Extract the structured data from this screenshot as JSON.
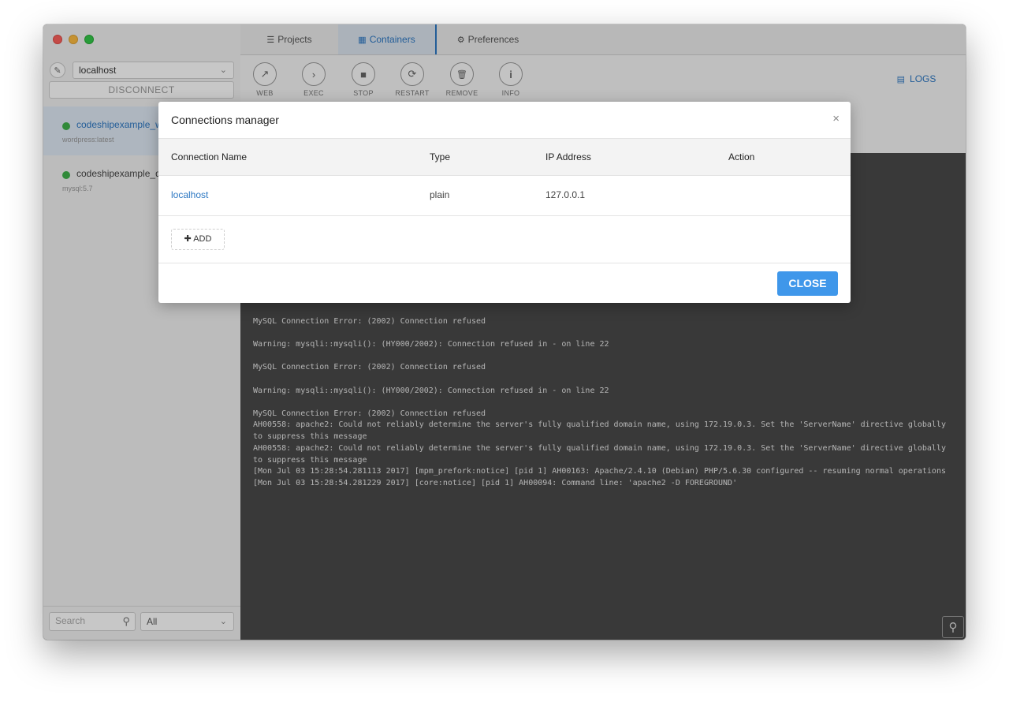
{
  "sidebar": {
    "host": "localhost",
    "disconnect_label": "DISCONNECT",
    "containers": [
      {
        "name": "codeshipexample_w",
        "image": "wordpress:latest",
        "status_color": "#3fb14b"
      },
      {
        "name": "codeshipexample_d",
        "image": "mysql:5.7",
        "status_color": "#3fb14b"
      }
    ],
    "search_placeholder": "Search",
    "filter_value": "All"
  },
  "tabs": [
    {
      "label": "Projects",
      "icon": "list-icon"
    },
    {
      "label": "Containers",
      "icon": "grid-icon"
    },
    {
      "label": "Preferences",
      "icon": "cogs-icon"
    }
  ],
  "toolbar": [
    {
      "label": "WEB",
      "icon": "external-link-icon",
      "glyph": "↗"
    },
    {
      "label": "EXEC",
      "icon": "chevron-right-icon",
      "glyph": "›"
    },
    {
      "label": "STOP",
      "icon": "stop-icon",
      "glyph": "■"
    },
    {
      "label": "RESTART",
      "icon": "refresh-icon",
      "glyph": "⟳"
    },
    {
      "label": "REMOVE",
      "icon": "trash-icon",
      "glyph": "🗑"
    },
    {
      "label": "INFO",
      "icon": "info-icon",
      "glyph": "i"
    }
  ],
  "logs_tab": {
    "label": "LOGS",
    "icon": "logs-icon"
  },
  "logs": [
    "MySQL Connection Error: (2002) Connection refused",
    "Warning: mysqli::mysqli(): (HY000/2002): Connection refused in - on line 22",
    "MySQL Connection Error: (2002) Connection refused",
    "Warning: mysqli::mysqli(): (HY000/2002): Connection refused in - on line 22",
    "MySQL Connection Error: (2002) Connection refused",
    "AH00558: apache2: Could not reliably determine the server's fully qualified domain name, using 172.19.0.3. Set the 'ServerName' directive globally to suppress this message",
    "AH00558: apache2: Could not reliably determine the server's fully qualified domain name, using 172.19.0.3. Set the 'ServerName' directive globally to suppress this message",
    "[Mon Jul 03 15:28:54.281113 2017] [mpm_prefork:notice] [pid 1] AH00163: Apache/2.4.10 (Debian) PHP/5.6.30 configured -- resuming normal operations",
    "[Mon Jul 03 15:28:54.281229 2017] [core:notice] [pid 1] AH00094: Command line: 'apache2 -D FOREGROUND'"
  ],
  "modal": {
    "title": "Connections manager",
    "close_icon": "×",
    "columns": [
      "Connection Name",
      "Type",
      "IP Address",
      "Action"
    ],
    "rows": [
      {
        "name": "localhost",
        "type": "plain",
        "ip": "127.0.0.1",
        "action": ""
      }
    ],
    "add_label": "ADD",
    "close_label": "CLOSE"
  }
}
